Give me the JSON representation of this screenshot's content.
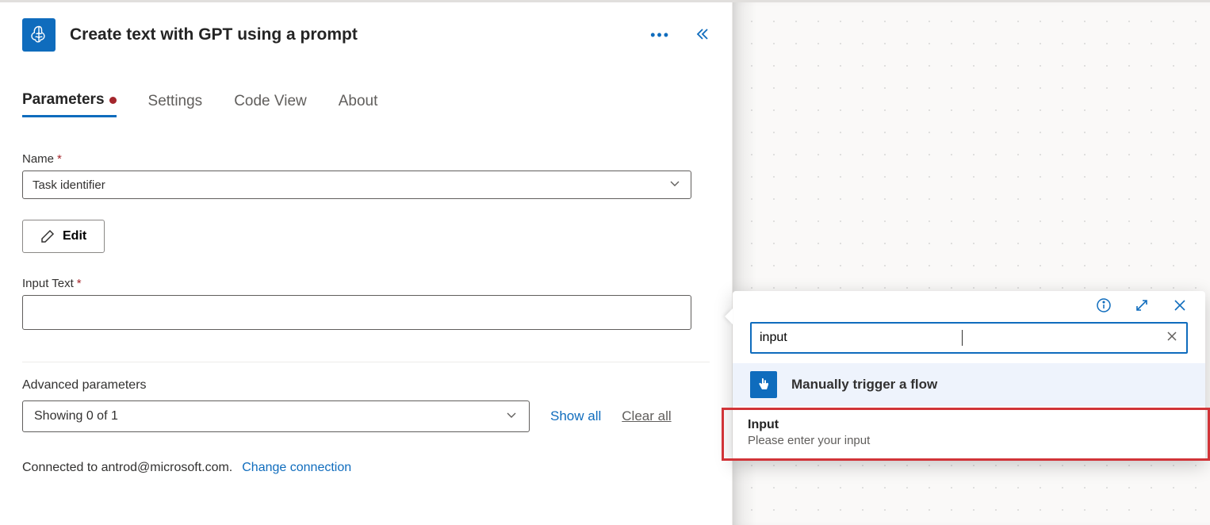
{
  "panel": {
    "title": "Create text with GPT using a prompt",
    "tabs": [
      {
        "label": "Parameters",
        "hasDot": true,
        "active": true
      },
      {
        "label": "Settings"
      },
      {
        "label": "Code View"
      },
      {
        "label": "About"
      }
    ]
  },
  "fields": {
    "nameLabel": "Name",
    "nameValue": "Task identifier",
    "editLabel": "Edit",
    "inputTextLabel": "Input Text",
    "inputTextValue": ""
  },
  "advanced": {
    "heading": "Advanced parameters",
    "selectLabel": "Showing 0 of 1",
    "showAll": "Show all",
    "clearAll": "Clear all"
  },
  "connection": {
    "prefix": "Connected to ",
    "email": "antrod@microsoft.com.",
    "changeLabel": "Change connection"
  },
  "popup": {
    "searchValue": "input",
    "triggerLabel": "Manually trigger a flow",
    "resultTitle": "Input",
    "resultSubtitle": "Please enter your input"
  }
}
